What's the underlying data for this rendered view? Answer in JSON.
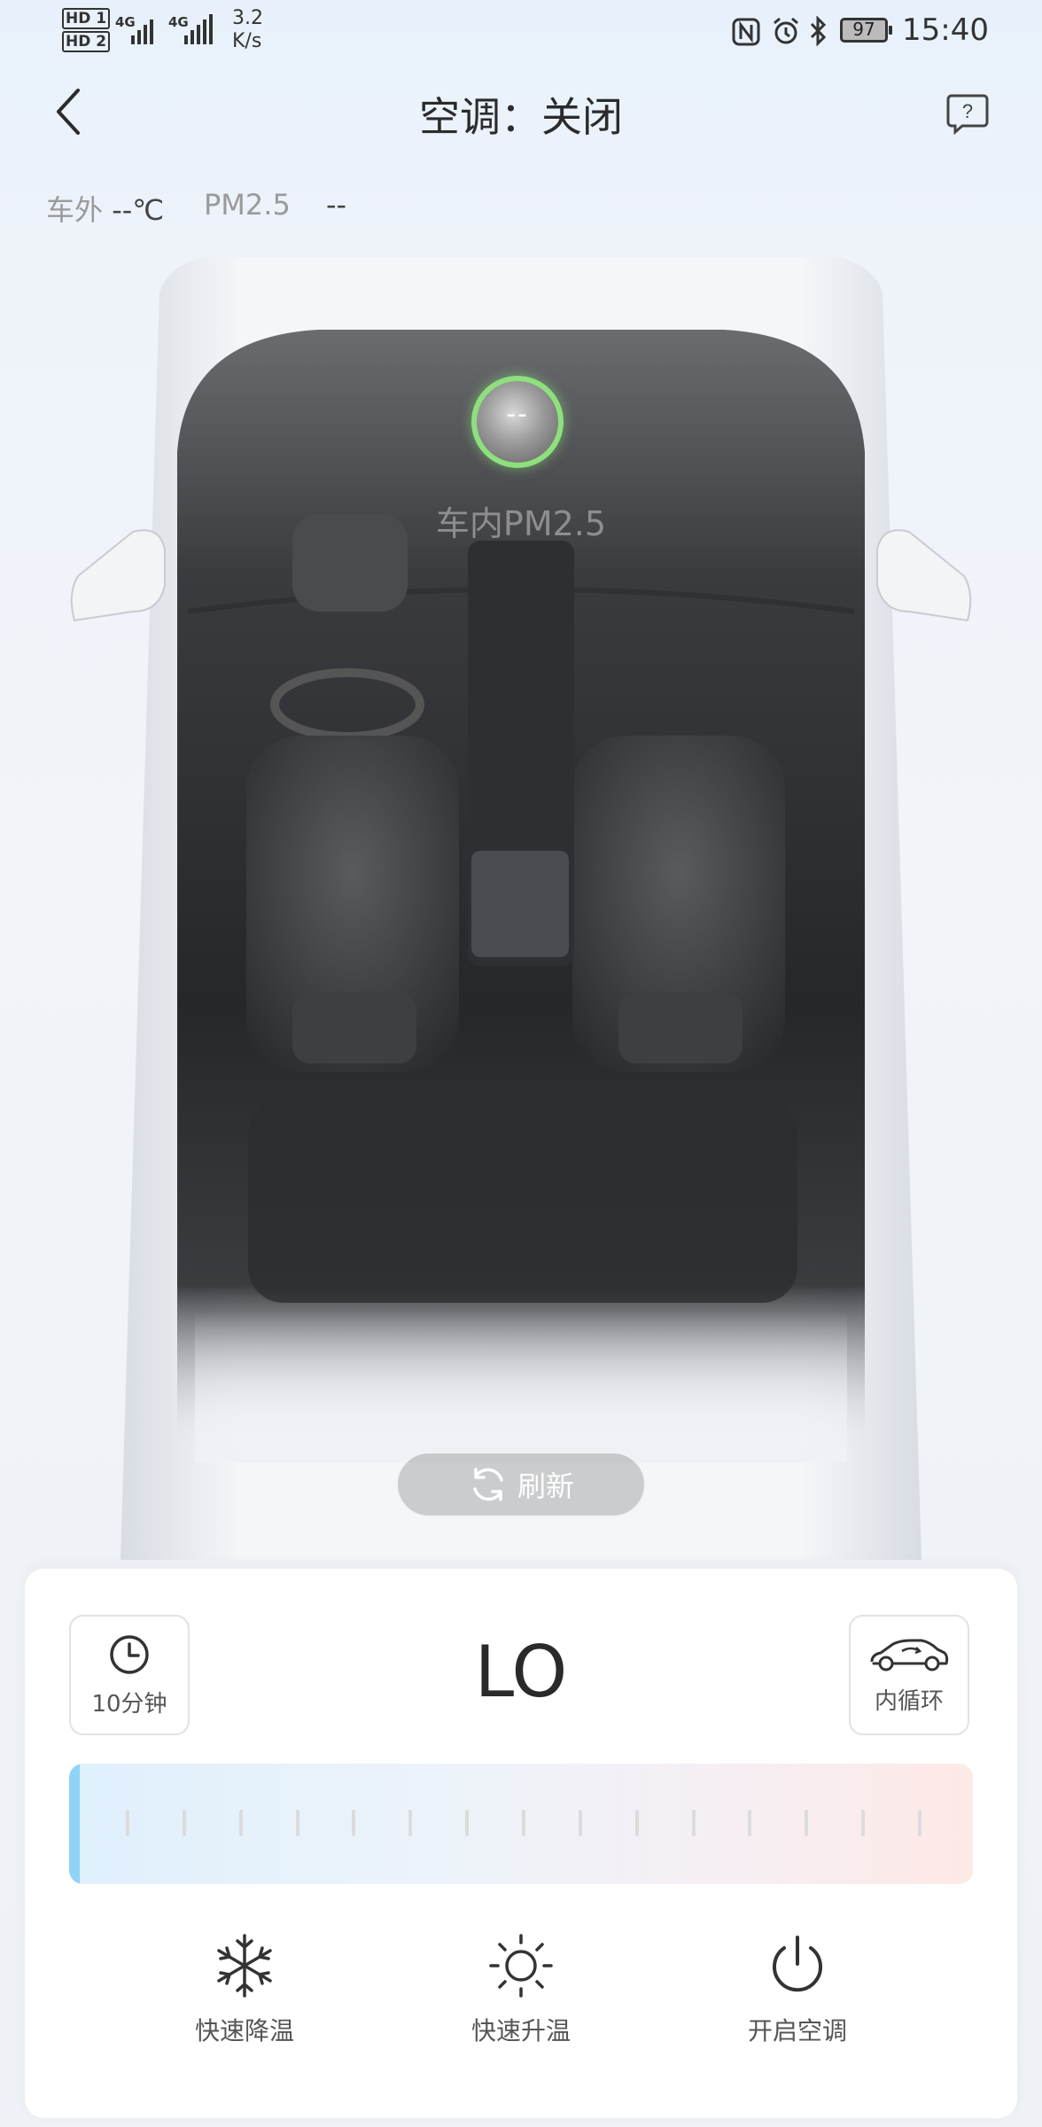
{
  "status_bar": {
    "sim1": "HD 1",
    "sim2": "HD 2",
    "net1": "4G",
    "net2": "4G",
    "speed_value": "3.2",
    "speed_unit": "K/s",
    "battery": "97",
    "time": "15:40",
    "icons": [
      "nfc-icon",
      "alarm-icon",
      "bluetooth-icon",
      "battery-icon"
    ]
  },
  "header": {
    "title": "空调：关闭"
  },
  "environment": {
    "outside_label": "车外",
    "outside_value": "--℃",
    "pm_label": "PM2.5",
    "pm_value": "--"
  },
  "cabin": {
    "pm_value": "--",
    "pm_label": "车内PM2.5",
    "refresh_label": "刷新"
  },
  "controls": {
    "timer_label": "10分钟",
    "temperature": "LO",
    "circulation_label": "内循环",
    "slider_level": 0.0,
    "slider_tick_count": 15,
    "actions": [
      {
        "label": "快速降温",
        "icon": "snowflake-icon"
      },
      {
        "label": "快速升温",
        "icon": "sun-icon"
      },
      {
        "label": "开启空调",
        "icon": "power-icon"
      }
    ]
  },
  "colors": {
    "ring_green": "#8ee07e",
    "slider_cool": "#8fd4f5",
    "slider_warm": "#fde9e6"
  }
}
